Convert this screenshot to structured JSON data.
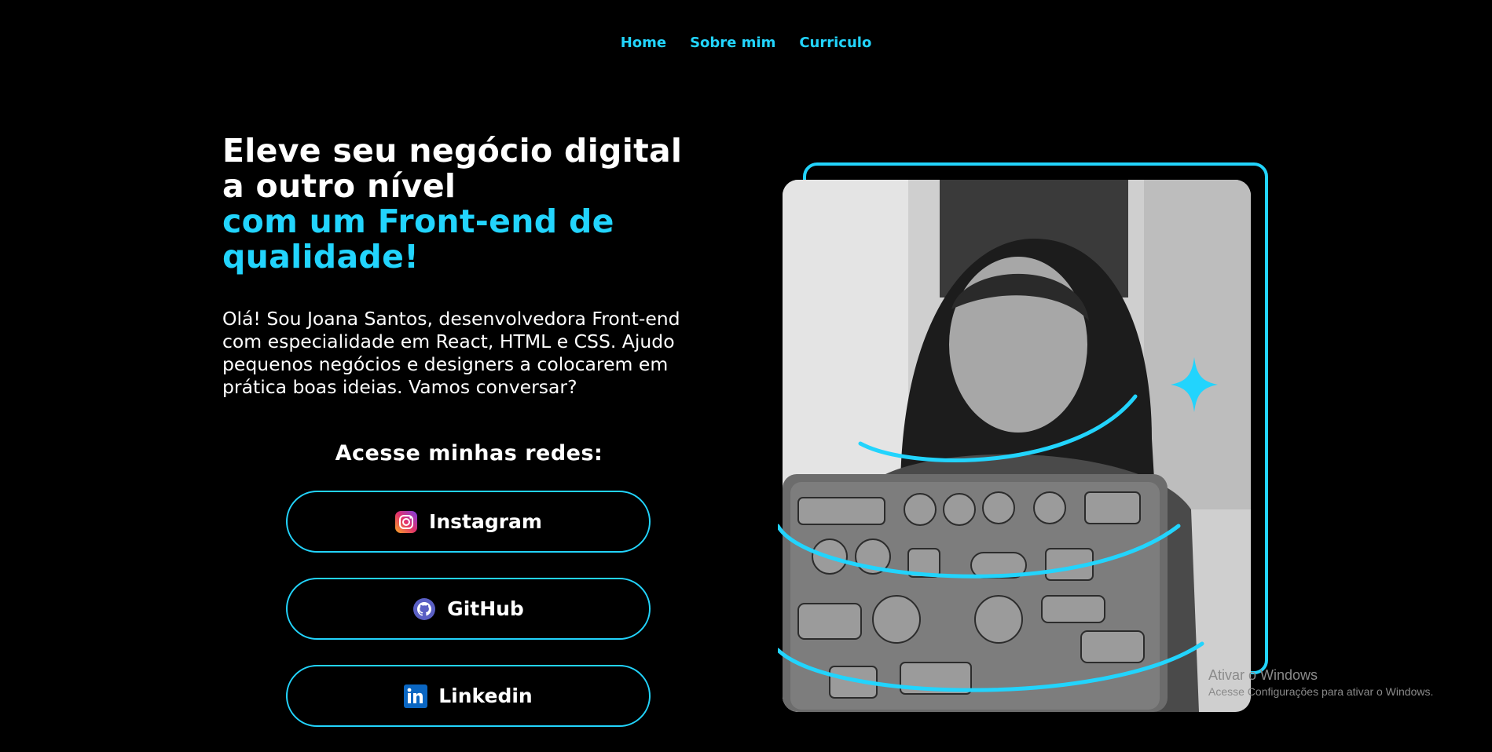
{
  "nav": {
    "items": [
      {
        "label": "Home"
      },
      {
        "label": "Sobre mim"
      },
      {
        "label": "Curriculo"
      }
    ]
  },
  "hero": {
    "headline_line1": "Eleve seu negócio digital",
    "headline_line2": "a outro nível",
    "headline_accent_line1": "com um Front-end de",
    "headline_accent_line2": "qualidade!",
    "intro": "Olá! Sou Joana Santos, desenvolvedora Front-end com especialidade em React, HTML e CSS. Ajudo pequenos negócios e designers a colocarem em prática boas ideias. Vamos conversar?"
  },
  "socials": {
    "title": "Acesse minhas redes:",
    "items": [
      {
        "label": "Instagram",
        "icon": "instagram-icon"
      },
      {
        "label": "GitHub",
        "icon": "github-icon"
      },
      {
        "label": "Linkedin",
        "icon": "linkedin-icon"
      }
    ]
  },
  "watermark": {
    "title": "Ativar o Windows",
    "subtitle": "Acesse Configurações para ativar o Windows."
  },
  "colors": {
    "background": "#000000",
    "accent": "#22d4fd",
    "text": "#ffffff"
  }
}
